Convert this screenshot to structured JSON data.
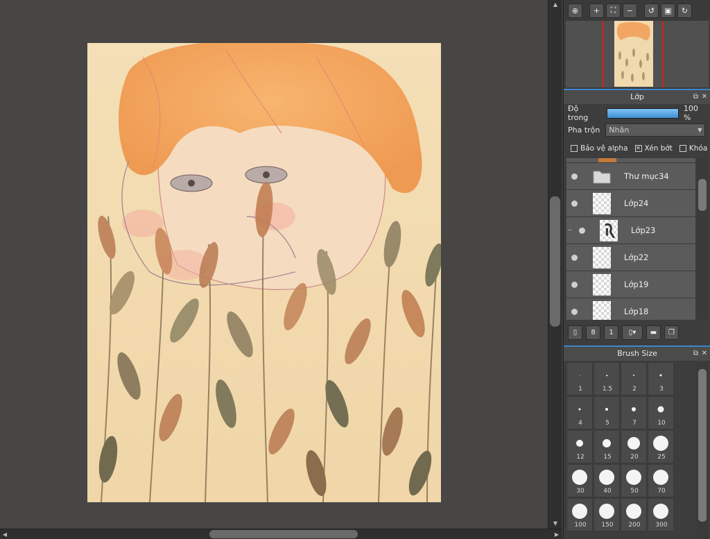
{
  "layers_panel": {
    "title": "Lớp",
    "opacity_label": "Độ trong",
    "opacity_value": "100 %",
    "blend_label": "Pha trộn",
    "blend_value": "Nhân",
    "protect_alpha_label": "Bảo vệ alpha",
    "clipping_label": "Xén bớt",
    "lock_label": "Khóa",
    "layers": [
      {
        "name": "Thư mục34",
        "type": "folder"
      },
      {
        "name": "Lớp24",
        "type": "layer"
      },
      {
        "name": "Lớp23",
        "type": "layer",
        "clipped": true
      },
      {
        "name": "Lớp22",
        "type": "layer"
      },
      {
        "name": "Lớp19",
        "type": "layer"
      },
      {
        "name": "Lớp18",
        "type": "layer"
      }
    ]
  },
  "brush_panel": {
    "title": "Brush Size",
    "sizes": [
      "1",
      "1.5",
      "2",
      "3",
      "4",
      "5",
      "7",
      "10",
      "12",
      "15",
      "20",
      "25",
      "30",
      "40",
      "50",
      "70",
      "100",
      "150",
      "200",
      "300"
    ]
  },
  "colors": {
    "accent_blue": "#3c86c9",
    "navigator_frame": "#d52020",
    "canvas_paper": "#f3dcb3"
  }
}
